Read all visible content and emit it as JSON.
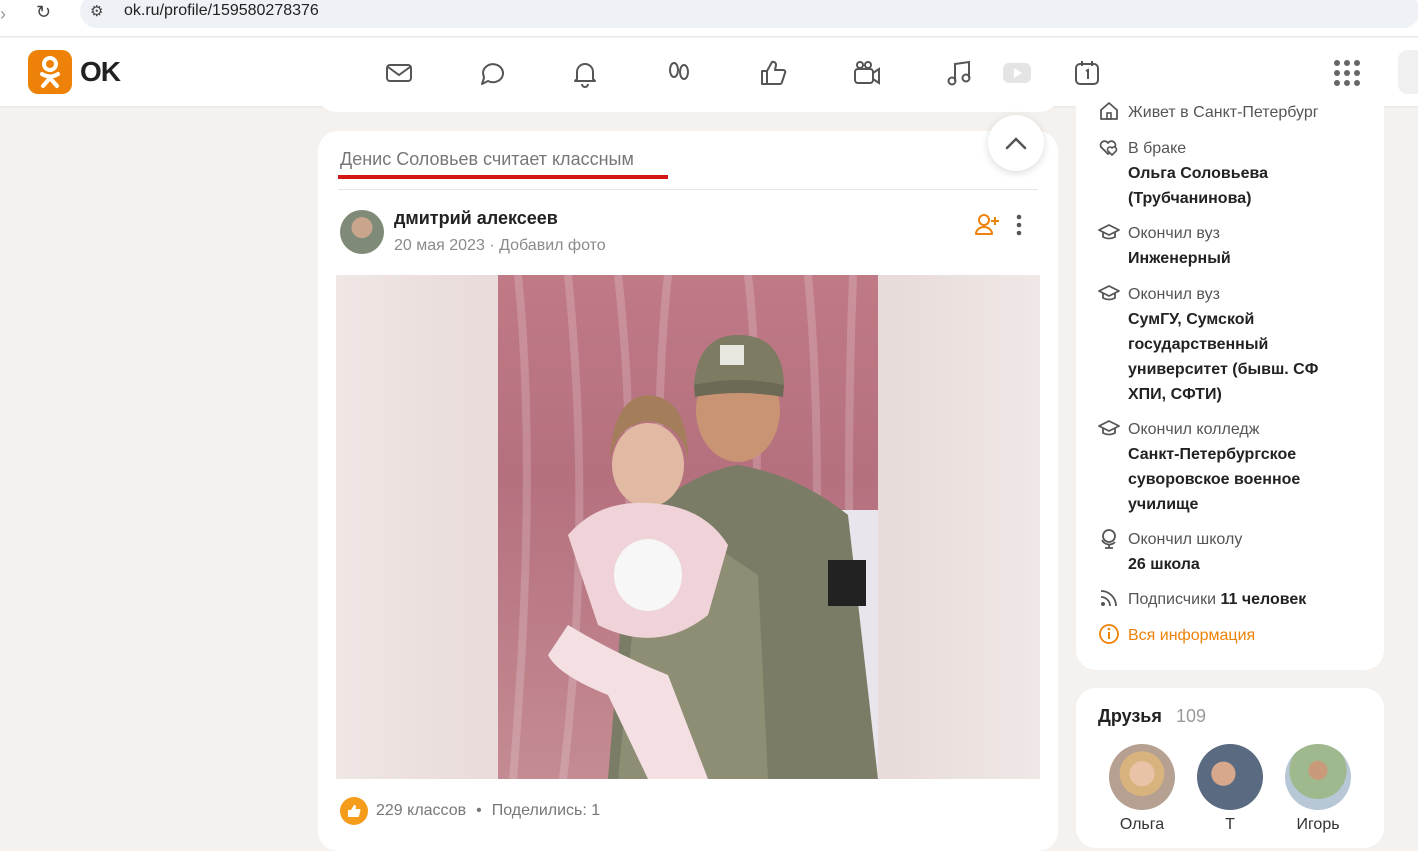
{
  "browser": {
    "url": "ok.ru/profile/159580278376"
  },
  "brand": {
    "name": "OK",
    "color": "#ee8208"
  },
  "nav": {
    "icons": [
      "mail-icon",
      "chat-icon",
      "bell-icon",
      "guests-icon",
      "likes-icon",
      "video-icon",
      "music-icon",
      "video-play-icon",
      "calendar-icon"
    ]
  },
  "feed": {
    "reason": "Денис Соловьев считает классным",
    "post": {
      "author": "дмитрий алексеев",
      "date": "20 мая 2023",
      "action": "Добавил фото",
      "likes_label": "229 классов",
      "shares_label": "Поделились: 1"
    }
  },
  "info": {
    "lives": "Живет в Санкт-Петербург",
    "married_label": "В браке",
    "spouse": "Ольга Соловьева (Трубчанинова)",
    "uni1_label": "Окончил вуз",
    "uni1": "Инженерный",
    "uni2_label": "Окончил вуз",
    "uni2": "СумГУ, Сумской государственный университет (бывш. СФ ХПИ, СФТИ)",
    "college_label": "Окончил колледж",
    "college": "Санкт-Петербургское суворовское военное училище",
    "school_label": "Окончил школу",
    "school": "26 школа",
    "subs_label": "Подписчики",
    "subs": "11 человек",
    "all_info": "Вся информация"
  },
  "friends": {
    "title": "Друзья",
    "count": "109",
    "list": [
      {
        "name": "Ольга"
      },
      {
        "name": "Т"
      },
      {
        "name": "Игорь"
      }
    ]
  }
}
